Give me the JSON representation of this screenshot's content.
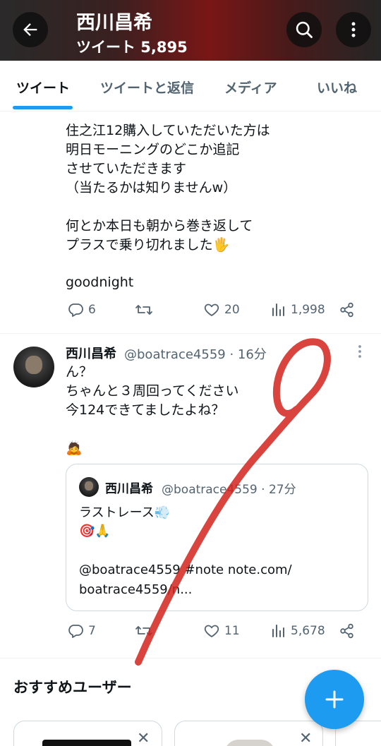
{
  "header": {
    "name": "西川昌希",
    "tweet_count": "ツイート 5,895"
  },
  "tabs": [
    {
      "label": "ツイート",
      "active": true
    },
    {
      "label": "ツイートと返信",
      "active": false
    },
    {
      "label": "メディア",
      "active": false
    },
    {
      "label": "いいね",
      "active": false
    }
  ],
  "tweet1": {
    "lines": [
      "住之江12購入していただいた方は",
      "明日モーニングのどこか追記",
      "させていただきます",
      "（当たるかは知りませんw）",
      "何とか本日も朝から巻き返して",
      "プラスで乗り切れました🖐",
      "goodnight"
    ],
    "replies": "6",
    "retweets": "",
    "likes": "20",
    "views": "1,998"
  },
  "tweet2": {
    "name": "西川昌希",
    "handle": "@boatrace4559 · 16分",
    "lines": [
      "ん？",
      "ちゃんと３周回ってください",
      "今124できてましたよね？",
      "🙇"
    ],
    "quote": {
      "name": "西川昌希",
      "handle": "@boatrace4559 · 27分",
      "lines": [
        "ラストレース💨",
        "🎯🙏",
        "@boatrace4559 #note note.com/",
        "boatrace4559/n..."
      ]
    },
    "replies": "7",
    "retweets": "",
    "likes": "11",
    "views": "5,678"
  },
  "recommended": {
    "title": "おすすめユーザー"
  },
  "colors": {
    "accent": "#1d9bf0",
    "secondary_text": "#536471",
    "annotation_stroke": "#d4231c"
  },
  "icons": {
    "back": "arrow-left-icon",
    "search": "search-icon",
    "more": "more-vertical-icon",
    "reply": "reply-icon",
    "retweet": "retweet-icon",
    "like": "heart-icon",
    "views": "analytics-icon",
    "share": "share-icon",
    "compose": "plus-icon"
  }
}
